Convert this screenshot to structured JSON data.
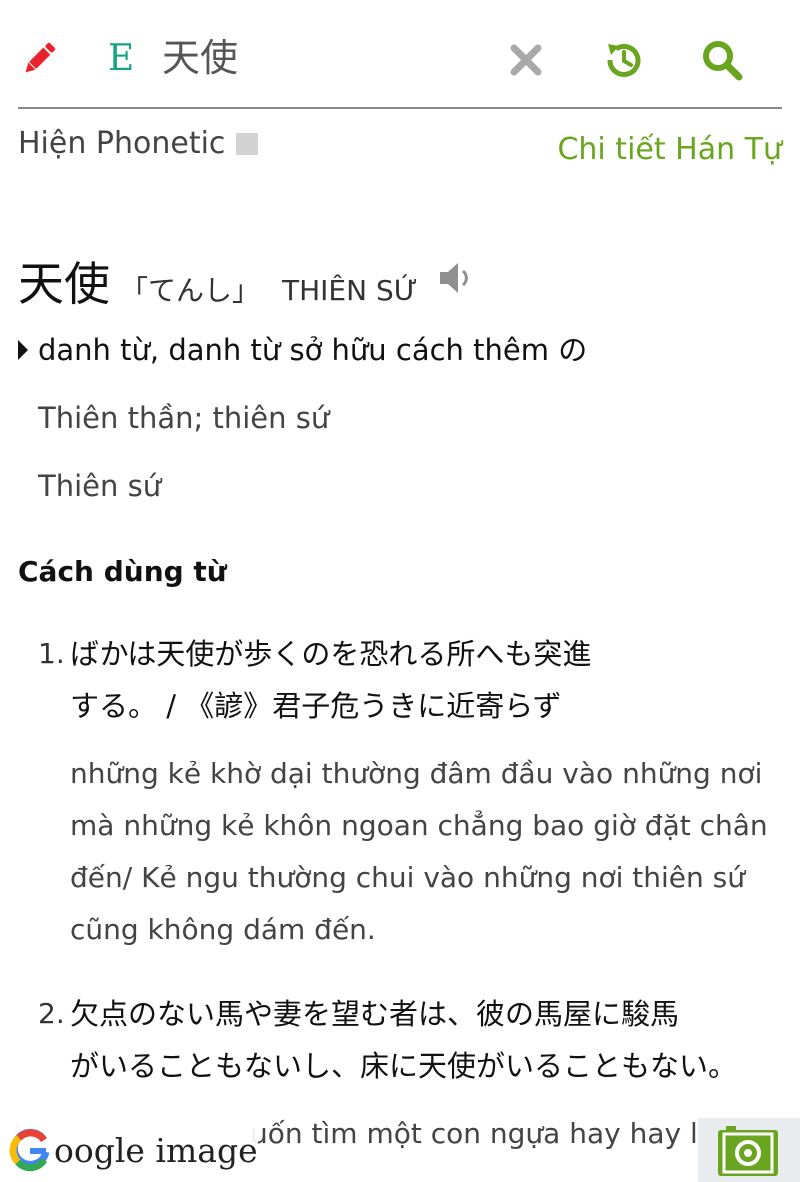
{
  "toolbar": {
    "edit_icon": "pencil-icon",
    "lang_label": "E",
    "search_value": "天使",
    "clear_icon": "close-icon",
    "history_icon": "history-icon",
    "search_icon": "search-icon",
    "colors": {
      "edit": "#e8232c",
      "lang": "#18a384",
      "action": "#6aa51f",
      "clear": "#a9a9a9"
    }
  },
  "phonetic": {
    "label": "Hiện Phonetic",
    "checked": false
  },
  "kanji_link": "Chi tiết Hán Tự",
  "entry": {
    "word": "天使",
    "reading": "「てんし」",
    "hanviet": "THIÊN SỨ",
    "speaker_icon": "speaker-icon",
    "part_of_speech": "danh từ, danh từ sở hữu cách thêm の",
    "meanings": [
      "Thiên thần; thiên sứ",
      "Thiên sứ"
    ]
  },
  "usage": {
    "heading": "Cách dùng từ",
    "examples": [
      {
        "num": "1.",
        "jp": "ばかは天使が歩くのを恐れる所へも突進\nする。 / 《諺》君子危うきに近寄らず",
        "vi": "những kẻ khờ dại thường đâm đầu vào những nơi mà những kẻ khôn ngoan chẳng bao giờ đặt chân đến/ Kẻ ngu thường chui vào những nơi thiên sứ cũng không dám đến."
      },
      {
        "num": "2.",
        "jp": "欠点のない馬や妻を望む者は、彼の馬屋に駿馬\nがいることもないし、床に天使がいることもない。",
        "vi": "uốn tìm một con ngựa hay hay l"
      }
    ]
  },
  "google_image": {
    "label": "oogle image",
    "icon": "google-g-icon"
  },
  "camera": {
    "icon": "camera-icon",
    "color": "#6aa51f"
  }
}
